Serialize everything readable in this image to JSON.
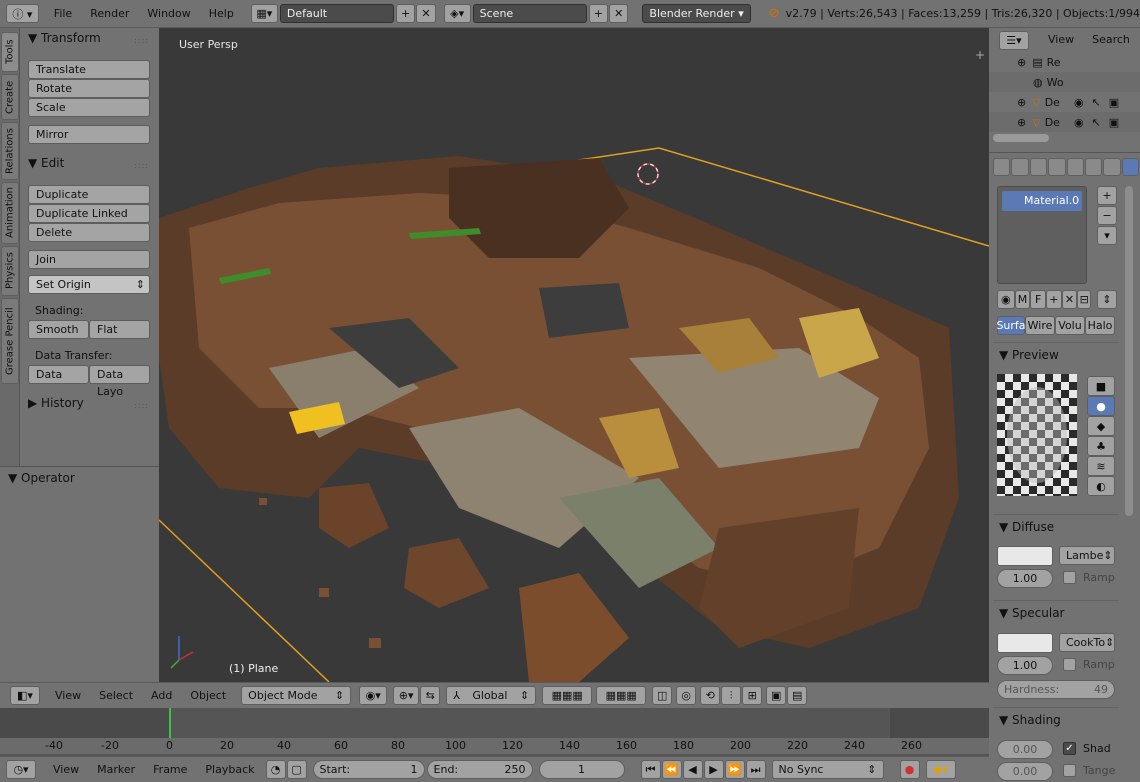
{
  "topbar": {
    "menus": [
      "File",
      "Render",
      "Window",
      "Help"
    ],
    "layout": "Default",
    "scene": "Scene",
    "engine": "Blender Render",
    "stats": "v2.79 | Verts:26,543 | Faces:13,259 | Tris:26,320 | Objects:1/994"
  },
  "tooltabs": [
    "Tools",
    "Create",
    "Relations",
    "Animation",
    "Physics",
    "Grease Pencil"
  ],
  "toolshelf": {
    "transform_title": "Transform",
    "translate": "Translate",
    "rotate": "Rotate",
    "scale": "Scale",
    "mirror": "Mirror",
    "edit_title": "Edit",
    "duplicate": "Duplicate",
    "duplicate_linked": "Duplicate Linked",
    "delete": "Delete",
    "join": "Join",
    "set_origin": "Set Origin",
    "shading_label": "Shading:",
    "smooth": "Smooth",
    "flat": "Flat",
    "data_transfer_label": "Data Transfer:",
    "data": "Data",
    "data_layout": "Data Layo",
    "history_title": "History",
    "operator_title": "Operator"
  },
  "viewport": {
    "title": "User Persp",
    "object_label": "(1) Plane"
  },
  "view3d_header": {
    "view": "View",
    "select": "Select",
    "add": "Add",
    "object": "Object",
    "mode": "Object Mode",
    "orientation": "Global"
  },
  "timeline": {
    "ticks": [
      "-40",
      "-20",
      "0",
      "20",
      "40",
      "60",
      "80",
      "100",
      "120",
      "140",
      "160",
      "180",
      "200",
      "220",
      "240",
      "260"
    ],
    "header": {
      "view": "View",
      "marker": "Marker",
      "frame": "Frame",
      "playback": "Playback",
      "start_label": "Start:",
      "start_value": "1",
      "end_label": "End:",
      "end_value": "250",
      "current_frame": "1",
      "sync": "No Sync"
    }
  },
  "outliner": {
    "view": "View",
    "search": "Search",
    "rows": [
      "Re",
      "Wo",
      "De",
      "De"
    ]
  },
  "properties": {
    "material_slot": "Material.0",
    "tabs": [
      "Surfa",
      "Wire",
      "Volu",
      "Halo"
    ],
    "m_label": "M",
    "f_label": "F",
    "preview_title": "Preview",
    "diffuse_title": "Diffuse",
    "diffuse_shader": "Lambe",
    "diffuse_intensity": "1.00",
    "ramp": "Ramp",
    "specular_title": "Specular",
    "specular_shader": "CookTo",
    "specular_intensity": "1.00",
    "hardness_label": "Hardness:",
    "hardness_value": "49",
    "shading_title": "Shading",
    "emit": "0.00",
    "shadeless": "Shad",
    "ambient": "0.00",
    "tangent": "Tange"
  }
}
